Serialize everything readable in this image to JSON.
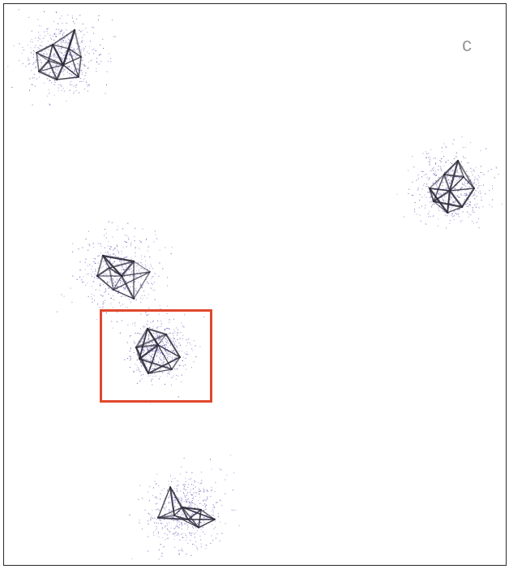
{
  "panel": {
    "letter": "c"
  },
  "colors": {
    "frame": "#2a2a2a",
    "points": "#5a4fb0",
    "edges": "#2e2a3a",
    "highlight": "#e0472d",
    "letter": "#9a9a9a"
  },
  "clusters": [
    {
      "name": "cluster-top-left",
      "highlighted": false
    },
    {
      "name": "cluster-right",
      "highlighted": false
    },
    {
      "name": "cluster-mid-left",
      "highlighted": false
    },
    {
      "name": "cluster-center",
      "highlighted": true
    },
    {
      "name": "cluster-bottom",
      "highlighted": false
    }
  ]
}
